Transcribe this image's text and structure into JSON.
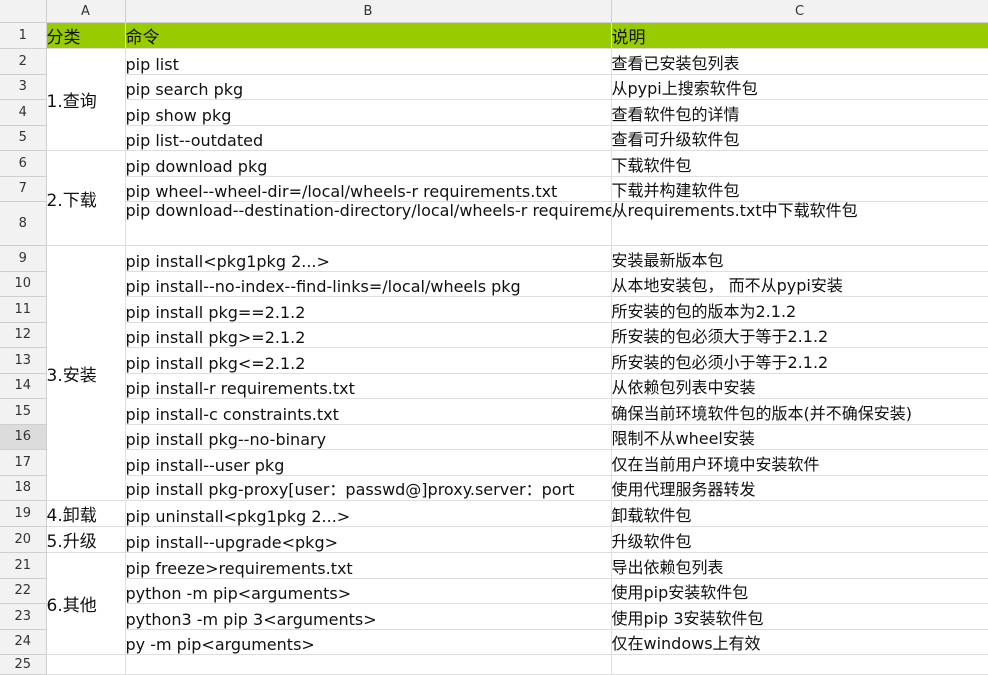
{
  "columns": [
    "A",
    "B",
    "C"
  ],
  "header": {
    "category": "分类",
    "command": "命令",
    "description": "说明"
  },
  "groups": [
    {
      "category": "1.查询",
      "rows": [
        {
          "row": "2",
          "command": "pip list",
          "description": "查看已安装包列表"
        },
        {
          "row": "3",
          "command": "pip search pkg",
          "description": "从pypi上搜索软件包"
        },
        {
          "row": "4",
          "command": "pip show pkg",
          "description": "查看软件包的详情"
        },
        {
          "row": "5",
          "command": "pip list--outdated",
          "description": "查看可升级软件包"
        }
      ]
    },
    {
      "category": "2.下载",
      "rows": [
        {
          "row": "6",
          "command": "pip download pkg",
          "description": "下载软件包"
        },
        {
          "row": "7",
          "command": "pip wheel--wheel-dir=/local/wheels-r requirements.txt",
          "description": "下载并构建软件包"
        },
        {
          "row": "8",
          "command": "pip download--destination-directory/local/wheels-r requirements.txt",
          "description": "从requirements.txt中下载软件包"
        }
      ]
    },
    {
      "category": "3.安装",
      "rows": [
        {
          "row": "9",
          "command": "pip install<pkg1pkg 2...>",
          "description": "安装最新版本包"
        },
        {
          "row": "10",
          "command": "pip install--no-index--find-links=/local/wheels pkg",
          "description": "从本地安装包， 而不从pypi安装"
        },
        {
          "row": "11",
          "command": "pip install pkg==2.1.2",
          "description": "所安装的包的版本为2.1.2"
        },
        {
          "row": "12",
          "command": "pip install pkg>=2.1.2",
          "description": "所安装的包必须大于等于2.1.2"
        },
        {
          "row": "13",
          "command": "pip install pkg<=2.1.2",
          "description": "所安装的包必须小于等于2.1.2"
        },
        {
          "row": "14",
          "command": "pip install-r requirements.txt",
          "description": "从依赖包列表中安装"
        },
        {
          "row": "15",
          "command": "pip install-c constraints.txt",
          "description": "确保当前环境软件包的版本(并不确保安装)"
        },
        {
          "row": "16",
          "command": "pip install pkg--no-binary",
          "description": "限制不从wheel安装"
        },
        {
          "row": "17",
          "command": "pip install--user pkg",
          "description": "仅在当前用户环境中安装软件"
        },
        {
          "row": "18",
          "command": "pip install pkg-proxy[user：passwd@]proxy.server：port",
          "description": "使用代理服务器转发"
        }
      ]
    },
    {
      "category": "4.卸载",
      "rows": [
        {
          "row": "19",
          "command": "pip uninstall<pkg1pkg 2...>",
          "description": "卸载软件包"
        }
      ]
    },
    {
      "category": "5.升级",
      "rows": [
        {
          "row": "20",
          "command": "pip install--upgrade<pkg>",
          "description": "升级软件包"
        }
      ]
    },
    {
      "category": "6.其他",
      "rows": [
        {
          "row": "21",
          "command": "pip freeze>requirements.txt",
          "description": "导出依赖包列表"
        },
        {
          "row": "22",
          "command": "python -m pip<arguments>",
          "description": "使用pip安装软件包"
        },
        {
          "row": "23",
          "command": "python3 -m pip 3<arguments>",
          "description": "使用pip 3安装软件包"
        },
        {
          "row": "24",
          "command": "py -m pip<arguments>",
          "description": "仅在windows上有效"
        }
      ]
    }
  ],
  "header_row_number": "1",
  "empty_row_number": "25",
  "selected_row": "16",
  "colors": {
    "header_fill": "#99cc00",
    "selected_row_header": "#dcdcdc"
  }
}
